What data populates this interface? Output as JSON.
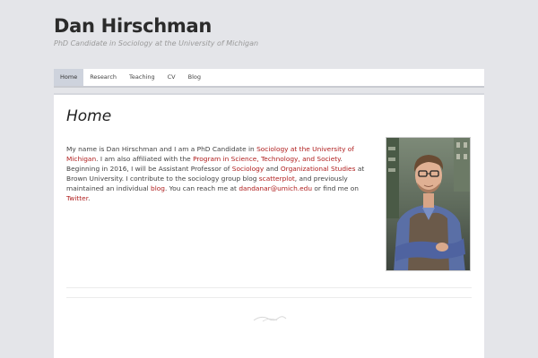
{
  "site": {
    "title": "Dan Hirschman",
    "description": "PhD Candidate in Sociology at the University of Michigan"
  },
  "nav": {
    "items": [
      {
        "label": "Home",
        "active": true
      },
      {
        "label": "Research",
        "active": false
      },
      {
        "label": "Teaching",
        "active": false
      },
      {
        "label": "CV",
        "active": false
      },
      {
        "label": "Blog",
        "active": false
      }
    ]
  },
  "entry": {
    "title": "Home",
    "t1": "My name is Dan Hirschman and I am a PhD Candidate in ",
    "l1": "Sociology at the University of Michigan",
    "t2": ". I am also affiliated with the ",
    "l2": "Program in Science, Technology, and Society",
    "t3": ". Beginning in 2016, I will be Assistant Professor of ",
    "l3": "Sociology",
    "t4": " and ",
    "l4": "Organizational Studies",
    "t5": " at Brown University. I contribute to the sociology group blog ",
    "l5": "scatterplot",
    "t6": ", and previously maintained an individual ",
    "l6": "blog",
    "t7": ". You can reach me at ",
    "l7": "dandanar@umich.edu",
    "t8": " or find me on ",
    "l8": "Twitter",
    "t9": "."
  },
  "photo": {
    "icon": "portrait-photo"
  },
  "colors": {
    "background": "#e4e5e9",
    "link": "#b02020",
    "nav_active": "#ced3dd"
  }
}
